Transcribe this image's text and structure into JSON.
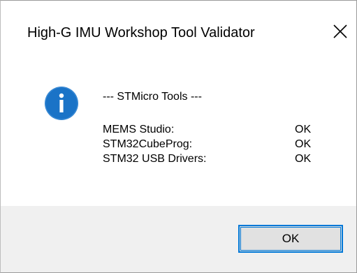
{
  "window": {
    "title": "High-G IMU Workshop Tool Validator"
  },
  "icons": {
    "info": "information-icon",
    "close": "close-icon"
  },
  "colors": {
    "info_icon": "#1a73c7",
    "button_border": "#0078d7",
    "footer_background": "#f0f0f0"
  },
  "message": {
    "heading": "--- STMicro Tools ---",
    "rows": [
      {
        "label": "MEMS Studio:",
        "status": "OK"
      },
      {
        "label": "STM32CubeProg:",
        "status": "OK"
      },
      {
        "label": "STM32 USB Drivers:",
        "status": "OK"
      }
    ]
  },
  "buttons": {
    "ok_label": "OK"
  }
}
